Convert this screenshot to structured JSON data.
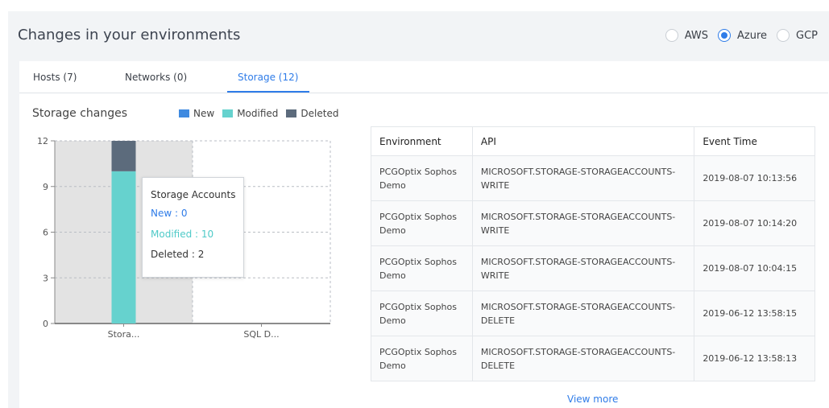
{
  "header": {
    "title": "Changes in your environments",
    "clouds": [
      {
        "label": "AWS",
        "selected": false
      },
      {
        "label": "Azure",
        "selected": true
      },
      {
        "label": "GCP",
        "selected": false
      }
    ]
  },
  "tabs": [
    {
      "label": "Hosts (7)",
      "active": false
    },
    {
      "label": "Networks (0)",
      "active": false
    },
    {
      "label": "Storage (12)",
      "active": true
    }
  ],
  "chart": {
    "title": "Storage changes",
    "legend": [
      {
        "label": "New",
        "color": "#3f8ae0"
      },
      {
        "label": "Modified",
        "color": "#66d2ce"
      },
      {
        "label": "Deleted",
        "color": "#5c6b7c"
      }
    ]
  },
  "chart_data": {
    "type": "bar",
    "stacked": true,
    "categories": [
      "Stora...",
      "SQL D..."
    ],
    "series": [
      {
        "name": "New",
        "values": [
          0,
          0
        ],
        "color": "#3f8ae0"
      },
      {
        "name": "Modified",
        "values": [
          10,
          0
        ],
        "color": "#66d2ce"
      },
      {
        "name": "Deleted",
        "values": [
          2,
          0
        ],
        "color": "#5c6b7c"
      }
    ],
    "ylim": [
      0,
      12
    ],
    "yticks": [
      0,
      3,
      6,
      9,
      12
    ],
    "grid": true,
    "highlighted_category": 0,
    "highlight_color": "#e3e3e3"
  },
  "tooltip": {
    "title": "Storage Accounts",
    "new": "New : 0",
    "modified": "Modified : 10",
    "deleted": "Deleted : 2"
  },
  "table": {
    "columns": [
      "Environment",
      "API",
      "Event Time"
    ],
    "rows": [
      {
        "environment": "PCGOptix Sophos Demo",
        "api": "MICROSOFT.STORAGE-STORAGEACCOUNTS-WRITE",
        "time": "2019-08-07 10:13:56"
      },
      {
        "environment": "PCGOptix Sophos Demo",
        "api": "MICROSOFT.STORAGE-STORAGEACCOUNTS-WRITE",
        "time": "2019-08-07 10:14:20"
      },
      {
        "environment": "PCGOptix Sophos Demo",
        "api": "MICROSOFT.STORAGE-STORAGEACCOUNTS-WRITE",
        "time": "2019-08-07 10:04:15"
      },
      {
        "environment": "PCGOptix Sophos Demo",
        "api": "MICROSOFT.STORAGE-STORAGEACCOUNTS-DELETE",
        "time": "2019-06-12 13:58:15"
      },
      {
        "environment": "PCGOptix Sophos Demo",
        "api": "MICROSOFT.STORAGE-STORAGEACCOUNTS-DELETE",
        "time": "2019-06-12 13:58:13"
      }
    ],
    "view_more": "View more"
  }
}
